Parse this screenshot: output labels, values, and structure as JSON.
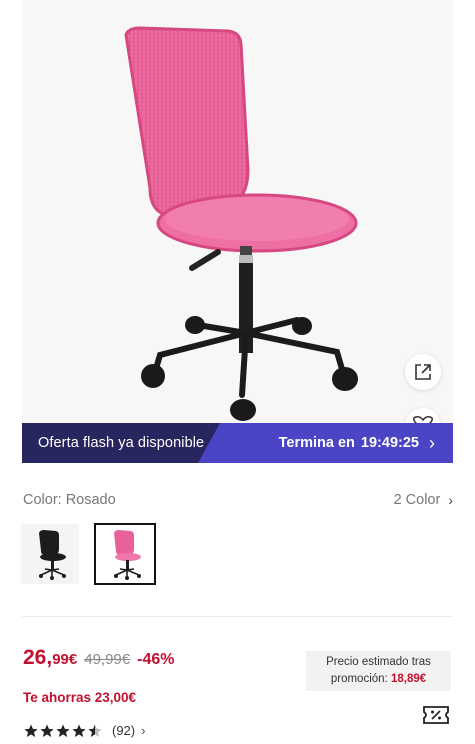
{
  "flash": {
    "left_text": "Oferta flash ya disponible",
    "timer_label": "Termina en",
    "hours": "19",
    "minutes": "49",
    "seconds": "25",
    "colors": {
      "left": "#28265f",
      "right": "#4a45c4"
    }
  },
  "color": {
    "label": "Color: Rosado",
    "count": "2 Color",
    "swatches": [
      {
        "name": "black",
        "color": "#1c1c1c"
      },
      {
        "name": "pink",
        "color": "#e8619b"
      }
    ]
  },
  "price": {
    "whole": "26,",
    "cents": "99€",
    "old": "49,99€",
    "discount": "-46%",
    "accent": "#c4102f"
  },
  "savings": "Te ahorras 23,00€",
  "promo": {
    "line1": "Precio estimado tras",
    "line2_label": "promoción:",
    "amount": "18,89€"
  },
  "rating": {
    "stars": 4.5,
    "count": "(92)"
  },
  "icons": {
    "share": "external-link-icon",
    "favorite": "heart-icon",
    "coupon": "coupon-icon"
  }
}
